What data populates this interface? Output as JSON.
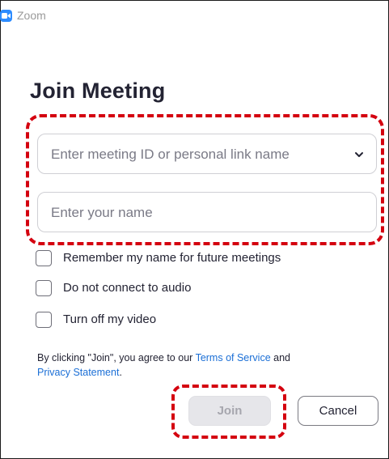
{
  "window": {
    "title": "Zoom",
    "app_icon": "zoom-camera-icon",
    "brand_color": "#2d8cff"
  },
  "dialog": {
    "heading": "Join Meeting",
    "meeting_id": {
      "value": "",
      "placeholder": "Enter meeting ID or personal link name",
      "dropdown_icon": "chevron-down-icon"
    },
    "name": {
      "value": "",
      "placeholder": "Enter your name"
    },
    "options": [
      {
        "label": "Remember my name for future meetings",
        "checked": false
      },
      {
        "label": "Do not connect to audio",
        "checked": false
      },
      {
        "label": "Turn off my video",
        "checked": false
      }
    ],
    "terms": {
      "prefix": "By clicking \"Join\", you agree to our ",
      "tos": "Terms of Service",
      "middle": " and",
      "privacy": "Privacy Statement",
      "suffix": "."
    },
    "buttons": {
      "join": "Join",
      "cancel": "Cancel"
    }
  },
  "annotation_color": "#d4000f"
}
